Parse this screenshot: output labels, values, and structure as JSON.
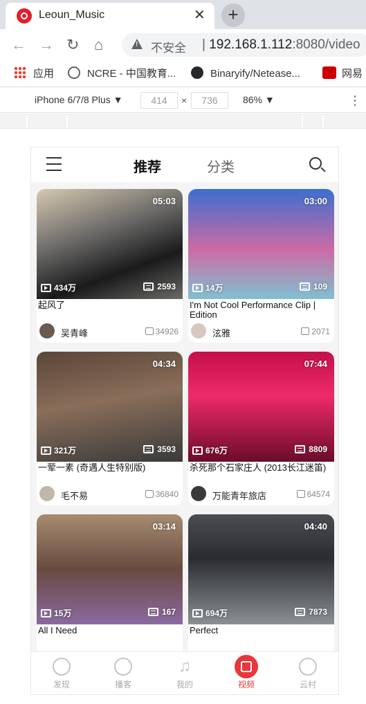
{
  "browser": {
    "tab_title": "Leoun_Music",
    "tab_close": "✕",
    "new_tab": "+",
    "insecure_label": "不安全",
    "url_host": "192.168.1.112",
    "url_rest": ":8080/video",
    "bookmarks": {
      "apps": "应用",
      "ncre": "NCRE - 中国教育...",
      "github": "Binaryify/Netease...",
      "netease": "网易"
    }
  },
  "devtools": {
    "device": "iPhone 6/7/8 Plus ▼",
    "width": "414",
    "height": "736",
    "times": "×",
    "zoom": "86% ▼",
    "menu": "⋮"
  },
  "app": {
    "header": {
      "tab_recommend": "推荐",
      "tab_category": "分类"
    },
    "videos": [
      {
        "title": "起风了",
        "duration": "05:03",
        "plays": "434万",
        "comments": "2593",
        "author": "吴青峰",
        "likes": "34926"
      },
      {
        "title": "I'm Not Cool Performance Clip | Edition",
        "duration": "03:00",
        "plays": "14万",
        "comments": "109",
        "author": "泫雅",
        "likes": "2071"
      },
      {
        "title": "一荤一素 (奇遇人生特别版)",
        "duration": "04:34",
        "plays": "321万",
        "comments": "3593",
        "author": "毛不易",
        "likes": "36840"
      },
      {
        "title": "杀死那个石家庄人 (2013长江迷笛)",
        "duration": "07:44",
        "plays": "676万",
        "comments": "8809",
        "author": "万能青年旅店",
        "likes": "64574"
      },
      {
        "title": "All I Need",
        "duration": "03:14",
        "plays": "15万",
        "comments": "167",
        "author": "",
        "likes": ""
      },
      {
        "title": "Perfect",
        "duration": "04:40",
        "plays": "694万",
        "comments": "7873",
        "author": "",
        "likes": ""
      }
    ],
    "bottom_tabs": [
      {
        "label": "发现",
        "icon": "discover-icon"
      },
      {
        "label": "播客",
        "icon": "podcast-icon"
      },
      {
        "label": "我的",
        "icon": "music-note-icon"
      },
      {
        "label": "视频",
        "icon": "video-icon",
        "active": true
      },
      {
        "label": "云村",
        "icon": "community-icon"
      }
    ],
    "accent_color": "#e8373c"
  }
}
